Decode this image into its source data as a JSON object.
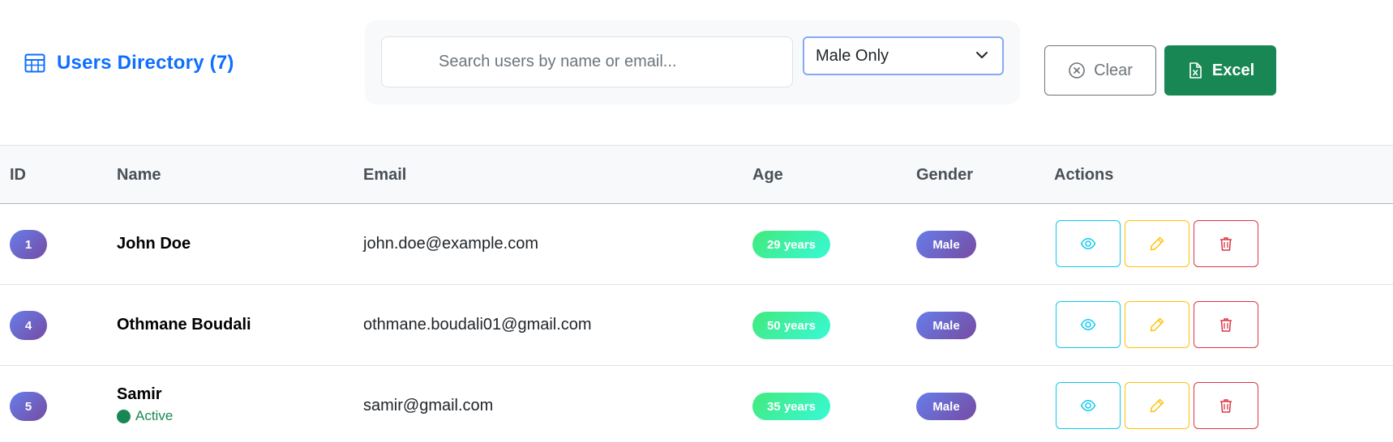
{
  "header": {
    "title": "Users Directory (7)",
    "search_placeholder": "Search users by name or email...",
    "gender_filter": "Male Only",
    "clear_label": "Clear",
    "excel_label": "Excel"
  },
  "table": {
    "columns": [
      "ID",
      "Name",
      "Email",
      "Age",
      "Gender",
      "Actions"
    ],
    "rows": [
      {
        "id": "1",
        "name": "John Doe",
        "status": "",
        "email": "john.doe@example.com",
        "age": "29 years",
        "gender": "Male"
      },
      {
        "id": "4",
        "name": "Othmane Boudali",
        "status": "",
        "email": "othmane.boudali01@gmail.com",
        "age": "50 years",
        "gender": "Male"
      },
      {
        "id": "5",
        "name": "Samir",
        "status": "Active",
        "email": "samir@gmail.com",
        "age": "35 years",
        "gender": "Male"
      }
    ]
  },
  "colors": {
    "primary": "#0d6efd",
    "success": "#198754",
    "info": "#0dcaf0",
    "warning": "#ffc107",
    "danger": "#dc3545"
  },
  "icons": {
    "title": "table-icon",
    "search": "search-icon",
    "select": "chevron-down-icon",
    "clear": "x-circle-icon",
    "excel": "file-excel-icon",
    "view": "eye-icon",
    "edit": "pencil-icon",
    "delete": "trash-icon"
  }
}
